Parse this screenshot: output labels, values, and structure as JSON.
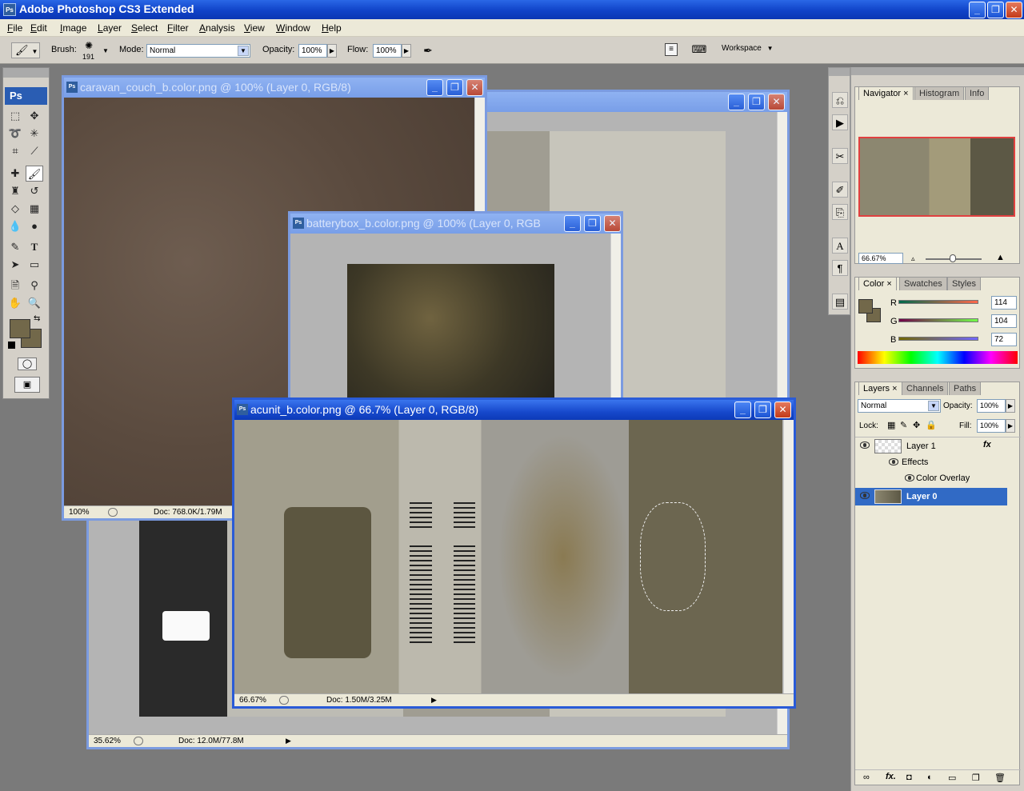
{
  "app": {
    "title": "Adobe Photoshop CS3 Extended",
    "logo": "Ps"
  },
  "menu": [
    "File",
    "Edit",
    "Image",
    "Layer",
    "Select",
    "Filter",
    "Analysis",
    "View",
    "Window",
    "Help"
  ],
  "options": {
    "brush_label": "Brush:",
    "brush_size": "191",
    "mode_label": "Mode:",
    "mode_value": "Normal",
    "opacity_label": "Opacity:",
    "opacity_value": "100%",
    "flow_label": "Flow:",
    "flow_value": "100%",
    "workspace_label": "Workspace"
  },
  "toolbox": {
    "logo": "Ps",
    "foreground_color": "#72684a",
    "background_color": "#72684a"
  },
  "documents": {
    "back": {
      "zoom": "35.62%",
      "doc": "Doc: 12.0M/77.8M"
    },
    "couch": {
      "title": "caravan_couch_b.color.png @ 100% (Layer 0, RGB/8)",
      "zoom": "100%",
      "doc": "Doc: 768.0K/1.79M"
    },
    "battery": {
      "title": "batterybox_b.color.png @ 100% (Layer 0, RGB"
    },
    "acunit": {
      "title": "acunit_b.color.png @ 66.7% (Layer 0, RGB/8)",
      "zoom": "66.67%",
      "doc": "Doc: 1.50M/3.25M"
    }
  },
  "navigator": {
    "tabs": [
      "Navigator",
      "Histogram",
      "Info"
    ],
    "zoom": "66.67%"
  },
  "color": {
    "tabs": [
      "Color",
      "Swatches",
      "Styles"
    ],
    "r_label": "R",
    "g_label": "G",
    "b_label": "B",
    "r": "114",
    "g": "104",
    "b": "72"
  },
  "layers": {
    "tabs": [
      "Layers",
      "Channels",
      "Paths"
    ],
    "blend_mode": "Normal",
    "opacity_label": "Opacity:",
    "opacity": "100%",
    "lock_label": "Lock:",
    "fill_label": "Fill:",
    "fill": "100%",
    "fx": "fx",
    "items": [
      "Layer 1",
      "Effects",
      "Color Overlay",
      "Layer 0"
    ]
  }
}
